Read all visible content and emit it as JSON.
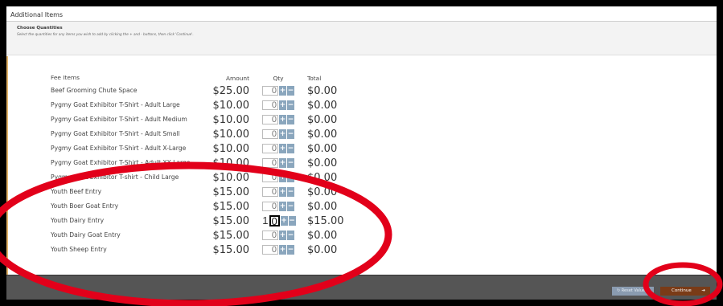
{
  "titlebar": {
    "title": "Additional Items"
  },
  "subhead": {
    "title": "Choose Quantities",
    "instructions": "Select the quantities for any items you wish to add by clicking the + and - buttons, then click 'Continue'."
  },
  "table": {
    "headers": {
      "item": "Fee Items",
      "amount": "Amount",
      "qty": "Qty",
      "total": "Total"
    },
    "rows": [
      {
        "item": "Beef Grooming Chute Space",
        "amount": "$25.00",
        "qty": "0",
        "total": "$0.00"
      },
      {
        "item": "Pygmy Goat Exhibitor T-Shirt - Adult Large",
        "amount": "$10.00",
        "qty": "0",
        "total": "$0.00"
      },
      {
        "item": "Pygmy Goat Exhibitor T-Shirt - Adult Medium",
        "amount": "$10.00",
        "qty": "0",
        "total": "$0.00"
      },
      {
        "item": "Pygmy Goat Exhibitor T-Shirt - Adult Small",
        "amount": "$10.00",
        "qty": "0",
        "total": "$0.00"
      },
      {
        "item": "Pygmy Goat Exhibitor T-Shirt - Adult X-Large",
        "amount": "$10.00",
        "qty": "0",
        "total": "$0.00"
      },
      {
        "item": "Pygmy Goat Exhibitor T-Shirt - Adult XX-Large",
        "amount": "$10.00",
        "qty": "0",
        "total": "$0.00"
      },
      {
        "item": "Pygmy Goat Exhibitor T-shirt - Child Large",
        "amount": "$10.00",
        "qty": "0",
        "total": "$0.00"
      },
      {
        "item": "Youth Beef Entry",
        "amount": "$15.00",
        "qty": "0",
        "total": "$0.00"
      },
      {
        "item": "Youth Boer Goat Entry",
        "amount": "$15.00",
        "qty": "0",
        "total": "$0.00"
      },
      {
        "item": "Youth Dairy Entry",
        "amount": "$15.00",
        "qty": "1",
        "qty_cursor": "0",
        "total": "$15.00"
      },
      {
        "item": "Youth Dairy Goat Entry",
        "amount": "$15.00",
        "qty": "0",
        "total": "$0.00"
      },
      {
        "item": "Youth Sheep Entry",
        "amount": "$15.00",
        "qty": "0",
        "total": "$0.00"
      }
    ]
  },
  "footer": {
    "reset_label": "Reset Values",
    "continue_label": "Continue"
  },
  "icons": {
    "plus": "+",
    "minus": "−",
    "reset": "↻",
    "continue_arrow": "➔"
  },
  "colors": {
    "annotation": "#e2001a",
    "continue_bg": "#7a3b17",
    "qty_buttons": "#8aa6bd"
  }
}
